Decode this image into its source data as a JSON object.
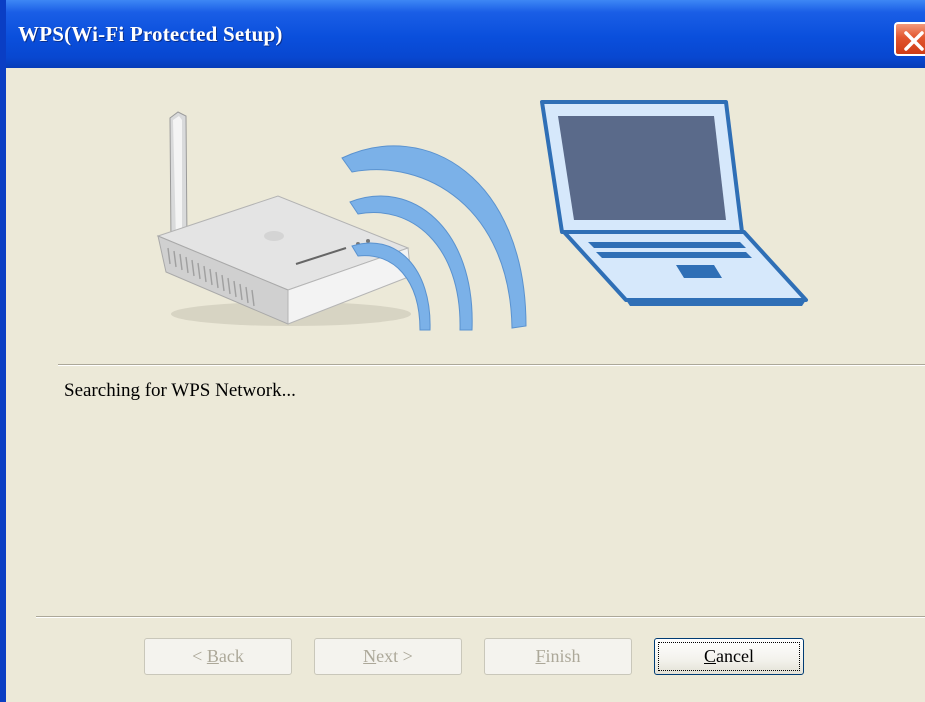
{
  "window": {
    "title": "WPS(Wi-Fi Protected Setup)"
  },
  "title_bar": {
    "close_icon": "close-icon"
  },
  "content": {
    "status_text": "Searching for WPS Network..."
  },
  "buttons": {
    "back": {
      "label": "< Back",
      "mnemonic": "B",
      "enabled": false
    },
    "next": {
      "label": "Next >",
      "mnemonic": "N",
      "enabled": false
    },
    "finish": {
      "label": "Finish",
      "mnemonic": "F",
      "enabled": false
    },
    "cancel": {
      "label": "Cancel",
      "mnemonic": "C",
      "enabled": true
    }
  },
  "illustration": {
    "router_icon": "wireless-router",
    "signal_icon": "wifi-signal-waves",
    "laptop_icon": "laptop"
  },
  "colors": {
    "title_bar": "#0a4fdc",
    "dialog_background": "#ece9d8",
    "wave": "#7bb1e8",
    "laptop_screen": "#5a6a8a"
  }
}
